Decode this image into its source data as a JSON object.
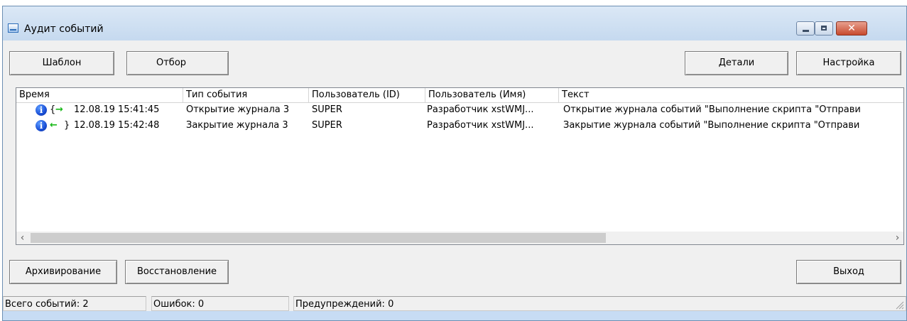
{
  "window": {
    "title": "Аудит событий"
  },
  "toolbar": {
    "template_label": "Шаблон",
    "filter_label": "Отбор",
    "details_label": "Детали",
    "settings_label": "Настройка"
  },
  "table": {
    "columns": [
      "Время",
      "Тип события",
      "Пользователь (ID)",
      "Пользователь (Имя)",
      "Текст"
    ],
    "rows": [
      {
        "icon": "info-icon",
        "marker_open": "{",
        "marker_arrow": "→",
        "marker_close": "",
        "time": "12.08.19 15:41:45",
        "type": "Открытие журнала 3",
        "user_id": "SUPER",
        "user_name": "Разработчик xstWMJ...",
        "text": "Открытие журнала событий \"Выполнение скрипта \"Отправи"
      },
      {
        "icon": "info-icon",
        "marker_open": "",
        "marker_arrow": "←",
        "marker_close": "}",
        "time": "12.08.19 15:42:48",
        "type": "Закрытие журнала 3",
        "user_id": "SUPER",
        "user_name": "Разработчик xstWMJ...",
        "text": "Закрытие журнала событий \"Выполнение скрипта \"Отправи"
      }
    ]
  },
  "bottom_buttons": {
    "archive_label": "Архивирование",
    "restore_label": "Восстановление",
    "exit_label": "Выход"
  },
  "status": {
    "total": "Всего событий: 2",
    "errors": "Ошибок: 0",
    "warnings": "Предупреждений: 0"
  }
}
